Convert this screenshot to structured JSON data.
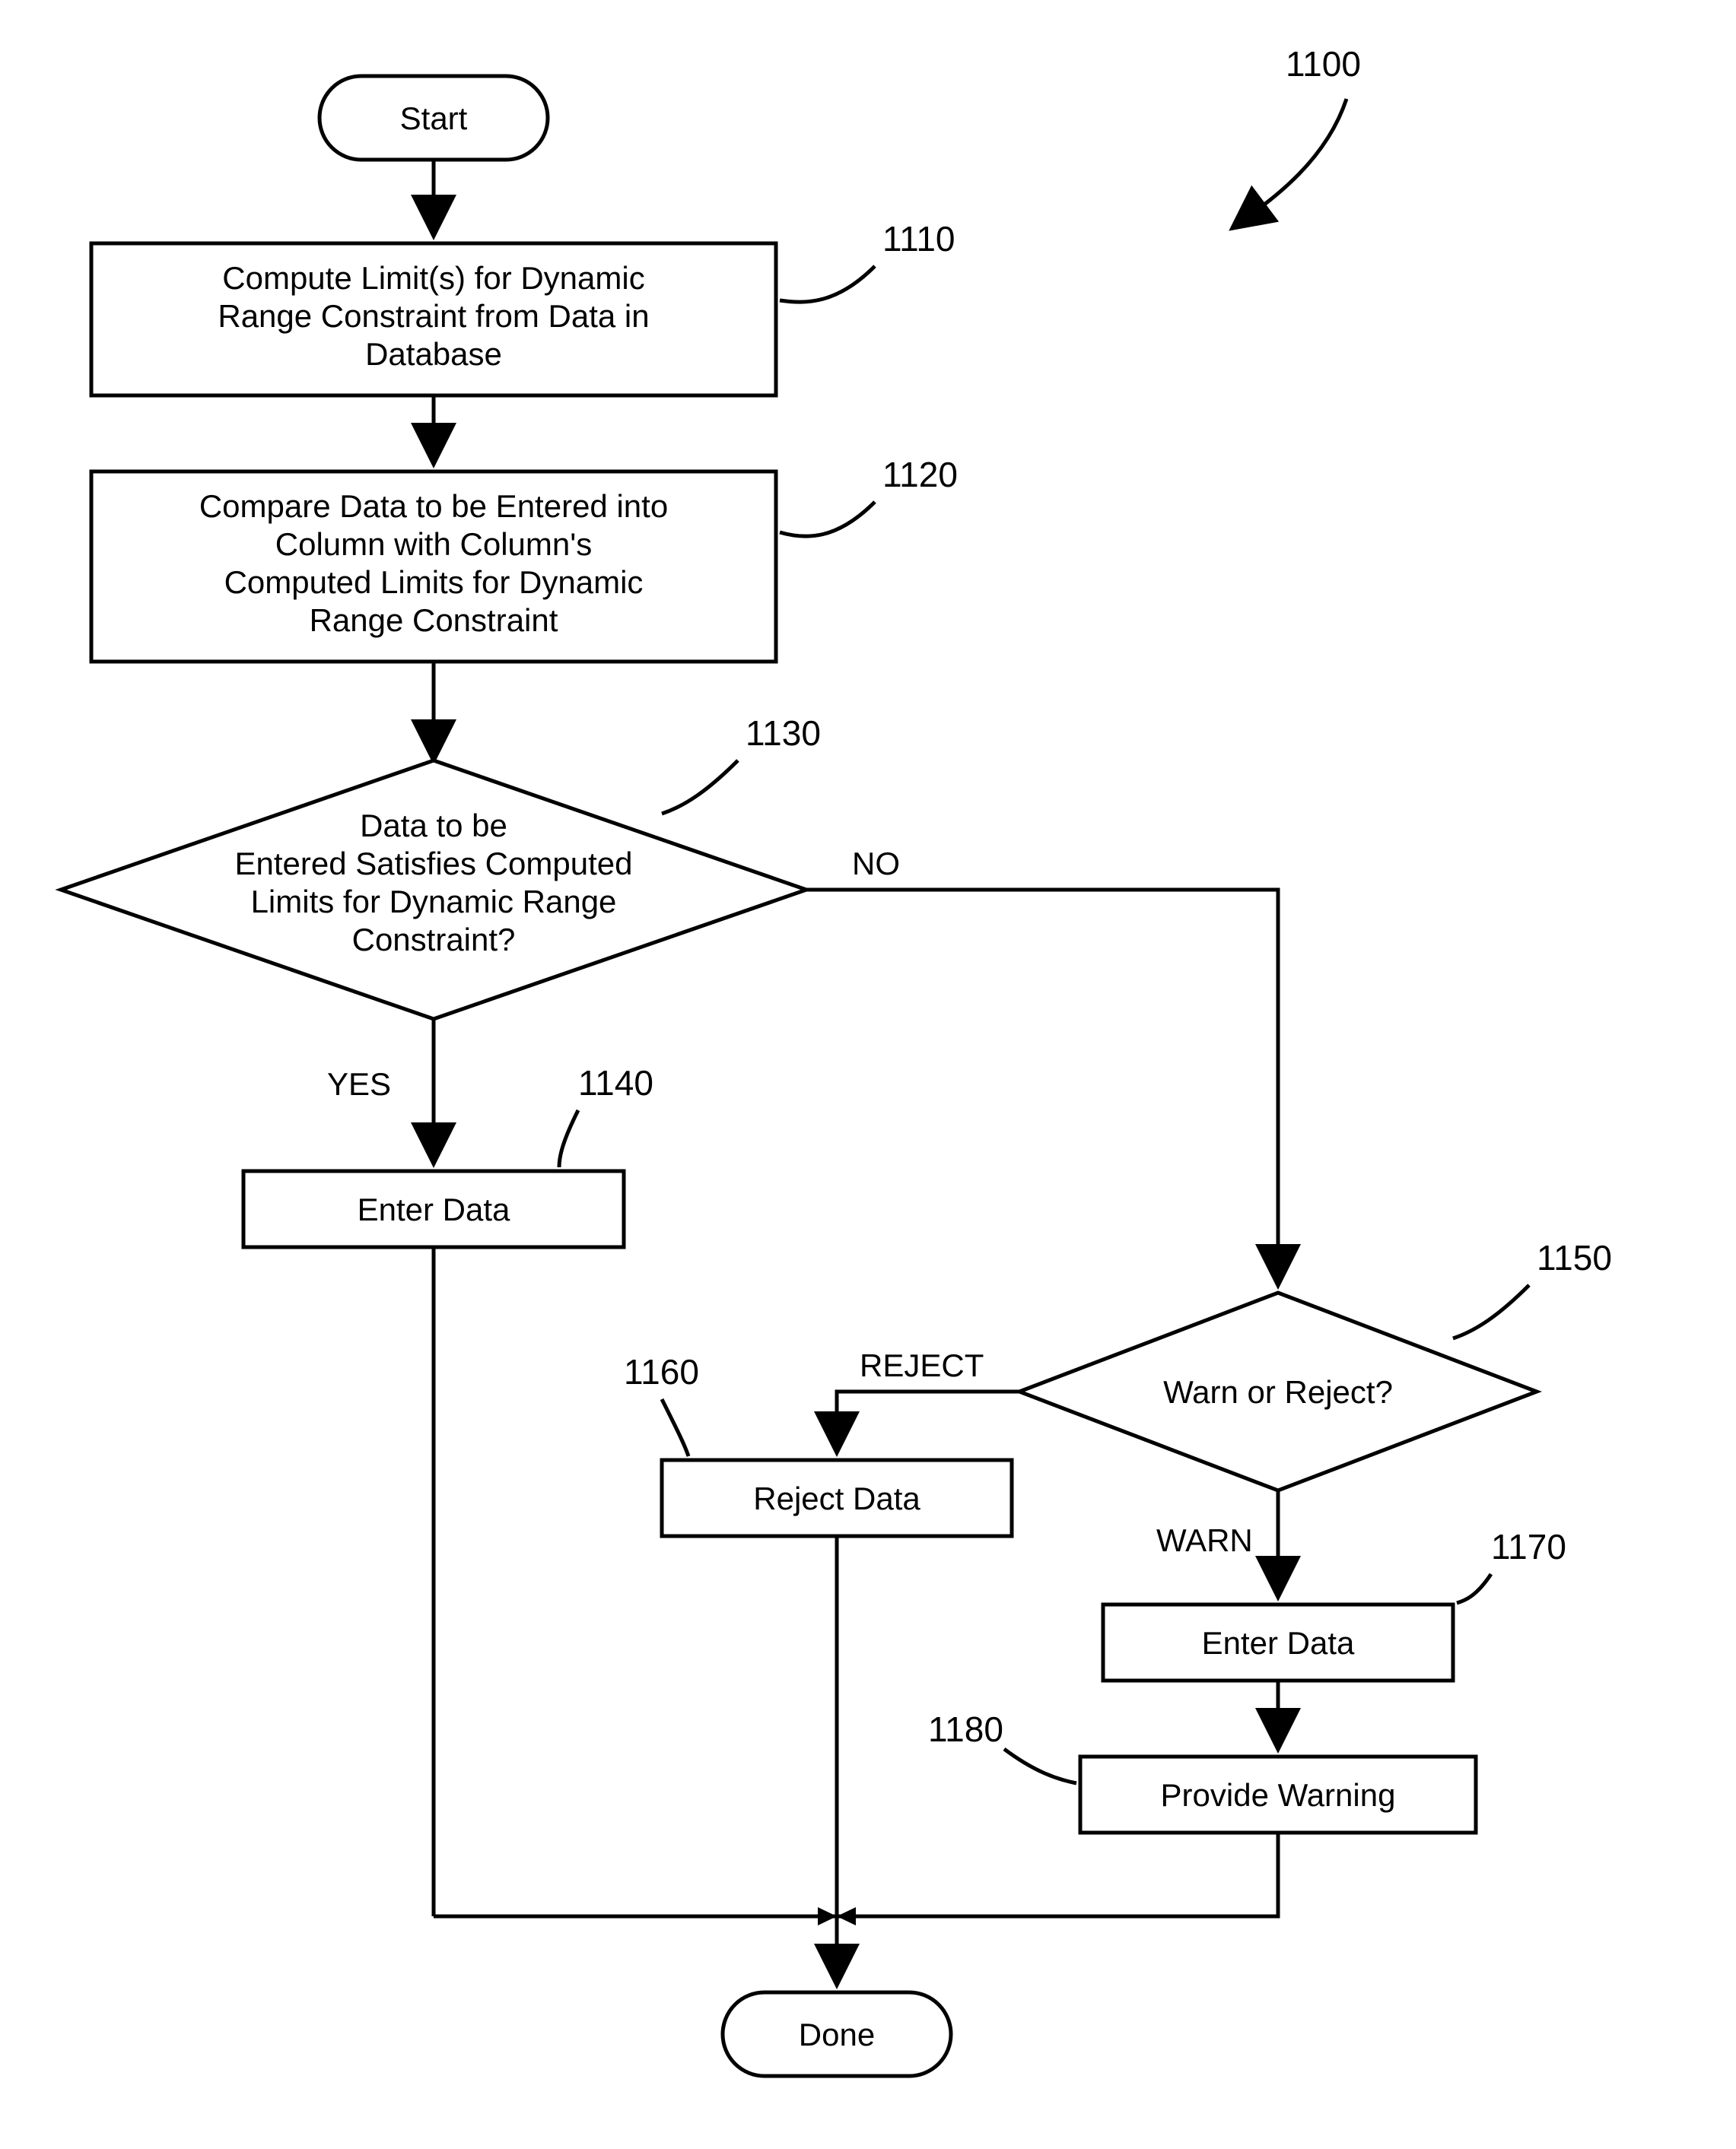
{
  "figure_ref": "1100",
  "nodes": {
    "start": {
      "text": "Start"
    },
    "compute": {
      "ref": "1110",
      "lines": [
        "Compute Limit(s) for Dynamic",
        "Range Constraint from Data in",
        "Database"
      ]
    },
    "compare": {
      "ref": "1120",
      "lines": [
        "Compare Data to be Entered into",
        "Column with Column's",
        "Computed Limits for Dynamic",
        "Range Constraint"
      ]
    },
    "dec1": {
      "ref": "1130",
      "lines": [
        "Data to be",
        "Entered Satisfies Computed",
        "Limits for Dynamic Range",
        "Constraint?"
      ]
    },
    "enter1": {
      "ref": "1140",
      "text": "Enter Data"
    },
    "dec2": {
      "ref": "1150",
      "text": "Warn or Reject?"
    },
    "reject": {
      "ref": "1160",
      "text": "Reject Data"
    },
    "enter2": {
      "ref": "1170",
      "text": "Enter Data"
    },
    "warn": {
      "ref": "1180",
      "text": "Provide Warning"
    },
    "done": {
      "text": "Done"
    }
  },
  "edges": {
    "yes": "YES",
    "no": "NO",
    "reject": "REJECT",
    "warn": "WARN"
  }
}
